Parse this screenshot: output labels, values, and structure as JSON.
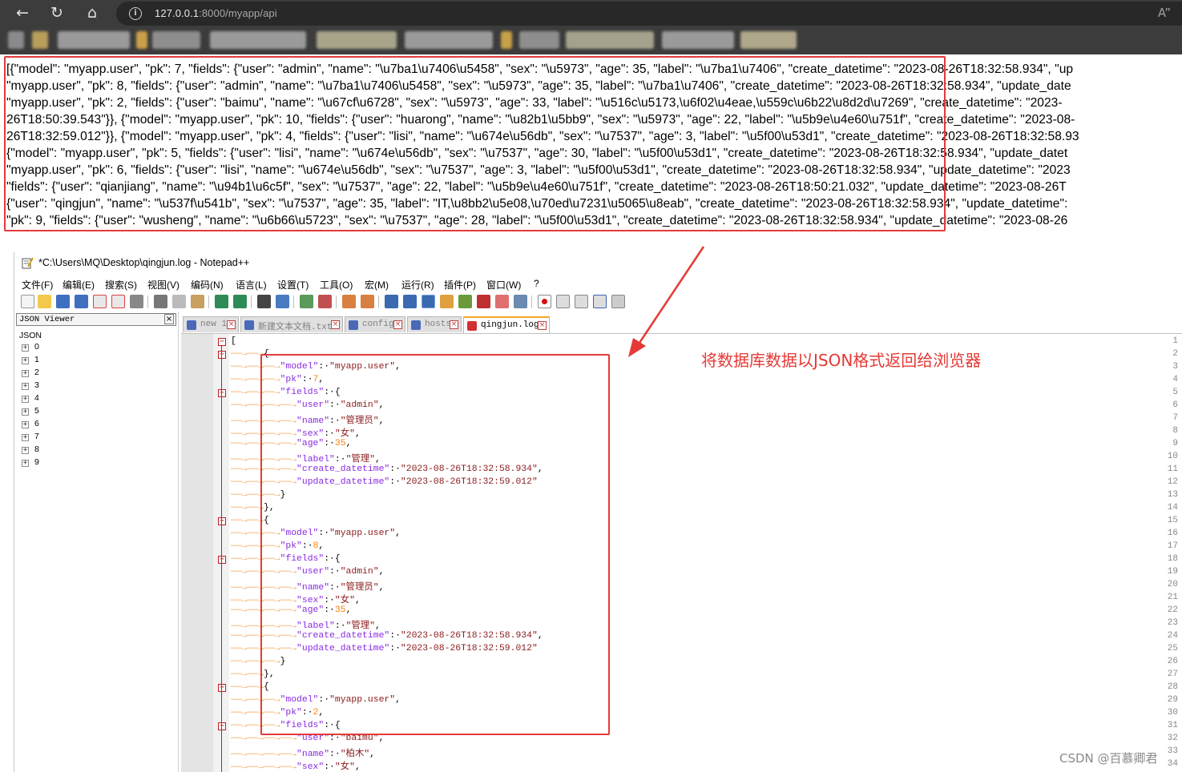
{
  "browser": {
    "url_host": "127.0.0.1",
    "url_rest": ":8000/myapp/api",
    "icons": [
      "back-icon",
      "reload-icon",
      "home-icon",
      "info-icon",
      "reader-mode-icon"
    ]
  },
  "response": {
    "lines": [
      "[{\"model\": \"myapp.user\", \"pk\": 7, \"fields\": {\"user\": \"admin\", \"name\": \"\\u7ba1\\u7406\\u5458\", \"sex\": \"\\u5973\", \"age\": 35, \"label\": \"\\u7ba1\\u7406\", \"create_datetime\": \"2023-08-26T18:32:58.934\", \"up",
      "\"myapp.user\", \"pk\": 8, \"fields\": {\"user\": \"admin\", \"name\": \"\\u7ba1\\u7406\\u5458\", \"sex\": \"\\u5973\", \"age\": 35, \"label\": \"\\u7ba1\\u7406\", \"create_datetime\": \"2023-08-26T18:32:58.934\", \"update_date",
      "\"myapp.user\", \"pk\": 2, \"fields\": {\"user\": \"baimu\", \"name\": \"\\u67cf\\u6728\", \"sex\": \"\\u5973\", \"age\": 33, \"label\": \"\\u516c\\u5173,\\u6f02\\u4eae,\\u559c\\u6b22\\u8d2d\\u7269\", \"create_datetime\": \"2023-",
      "26T18:50:39.543\"}}, {\"model\": \"myapp.user\", \"pk\": 10, \"fields\": {\"user\": \"huarong\", \"name\": \"\\u82b1\\u5bb9\", \"sex\": \"\\u5973\", \"age\": 22, \"label\": \"\\u5b9e\\u4e60\\u751f\", \"create_datetime\": \"2023-08-",
      "26T18:32:59.012\"}}, {\"model\": \"myapp.user\", \"pk\": 4, \"fields\": {\"user\": \"lisi\", \"name\": \"\\u674e\\u56db\", \"sex\": \"\\u7537\", \"age\": 3, \"label\": \"\\u5f00\\u53d1\", \"create_datetime\": \"2023-08-26T18:32:58.93",
      "{\"model\": \"myapp.user\", \"pk\": 5, \"fields\": {\"user\": \"lisi\", \"name\": \"\\u674e\\u56db\", \"sex\": \"\\u7537\", \"age\": 30, \"label\": \"\\u5f00\\u53d1\", \"create_datetime\": \"2023-08-26T18:32:58.934\", \"update_datet",
      "\"myapp.user\", \"pk\": 6, \"fields\": {\"user\": \"lisi\", \"name\": \"\\u674e\\u56db\", \"sex\": \"\\u7537\", \"age\": 3, \"label\": \"\\u5f00\\u53d1\", \"create_datetime\": \"2023-08-26T18:32:58.934\", \"update_datetime\": \"2023",
      "\"fields\": {\"user\": \"qianjiang\", \"name\": \"\\u94b1\\u6c5f\", \"sex\": \"\\u7537\", \"age\": 22, \"label\": \"\\u5b9e\\u4e60\\u751f\", \"create_datetime\": \"2023-08-26T18:50:21.032\", \"update_datetime\": \"2023-08-26T",
      "{\"user\": \"qingjun\", \"name\": \"\\u537f\\u541b\", \"sex\": \"\\u7537\", \"age\": 35, \"label\": \"IT,\\u8bb2\\u5e08,\\u70ed\\u7231\\u5065\\u8eab\", \"create_datetime\": \"2023-08-26T18:32:58.934\", \"update_datetime\":",
      "\"pk\": 9, \"fields\": {\"user\": \"wusheng\", \"name\": \"\\u6b66\\u5723\", \"sex\": \"\\u7537\", \"age\": 28, \"label\": \"\\u5f00\\u53d1\", \"create_datetime\": \"2023-08-26T18:32:58.934\", \"update_datetime\": \"2023-08-26"
    ]
  },
  "notepad": {
    "title": "*C:\\Users\\MQ\\Desktop\\qingjun.log - Notepad++",
    "menu": [
      "文件(F)",
      "编辑(E)",
      "搜索(S)",
      "视图(V)",
      "编码(N)",
      "语言(L)",
      "设置(T)",
      "工具(O)",
      "宏(M)",
      "运行(R)",
      "插件(P)",
      "窗口(W)",
      "?"
    ],
    "json_viewer": {
      "header": "JSON Viewer",
      "root": "JSON",
      "nodes": [
        "0",
        "1",
        "2",
        "3",
        "4",
        "5",
        "6",
        "7",
        "8",
        "9"
      ]
    },
    "tabs": [
      {
        "label": "new 1",
        "active": false
      },
      {
        "label": "新建文本文档.txt",
        "active": false
      },
      {
        "label": "config",
        "active": false
      },
      {
        "label": "hosts",
        "active": false
      },
      {
        "label": "qingjun.log",
        "active": true
      }
    ],
    "line_numbers": [
      "1",
      "2",
      "3",
      "4",
      "5",
      "6",
      "7",
      "8",
      "9",
      "10",
      "11",
      "12",
      "13",
      "14",
      "15",
      "16",
      "17",
      "18",
      "19",
      "20",
      "21",
      "22",
      "23",
      "24",
      "25",
      "26",
      "27",
      "28",
      "29",
      "30",
      "31",
      "32",
      "33",
      "34"
    ],
    "code_lines": [
      {
        "indent": 0,
        "tokens": [
          [
            "p",
            "["
          ]
        ]
      },
      {
        "indent": 1,
        "tokens": [
          [
            "p",
            "{"
          ]
        ]
      },
      {
        "indent": 2,
        "tokens": [
          [
            "k",
            "\"model\""
          ],
          [
            "p",
            ":·"
          ],
          [
            "s",
            "\"myapp.user\""
          ],
          [
            "p",
            ","
          ]
        ]
      },
      {
        "indent": 2,
        "tokens": [
          [
            "k",
            "\"pk\""
          ],
          [
            "p",
            ":·"
          ],
          [
            "n",
            "7"
          ],
          [
            "p",
            ","
          ]
        ]
      },
      {
        "indent": 2,
        "tokens": [
          [
            "k",
            "\"fields\""
          ],
          [
            "p",
            ":·{"
          ]
        ]
      },
      {
        "indent": 3,
        "tokens": [
          [
            "k",
            "\"user\""
          ],
          [
            "p",
            ":·"
          ],
          [
            "s",
            "\"admin\""
          ],
          [
            "p",
            ","
          ]
        ]
      },
      {
        "indent": 3,
        "tokens": [
          [
            "k",
            "\"name\""
          ],
          [
            "p",
            ":·"
          ],
          [
            "s",
            "\"管理员\""
          ],
          [
            "p",
            ","
          ]
        ]
      },
      {
        "indent": 3,
        "tokens": [
          [
            "k",
            "\"sex\""
          ],
          [
            "p",
            ":·"
          ],
          [
            "s",
            "\"女\""
          ],
          [
            "p",
            ","
          ]
        ]
      },
      {
        "indent": 3,
        "tokens": [
          [
            "k",
            "\"age\""
          ],
          [
            "p",
            ":·"
          ],
          [
            "n",
            "35"
          ],
          [
            "p",
            ","
          ]
        ]
      },
      {
        "indent": 3,
        "tokens": [
          [
            "k",
            "\"label\""
          ],
          [
            "p",
            ":·"
          ],
          [
            "s",
            "\"管理\""
          ],
          [
            "p",
            ","
          ]
        ]
      },
      {
        "indent": 3,
        "tokens": [
          [
            "k",
            "\"create_datetime\""
          ],
          [
            "p",
            ":·"
          ],
          [
            "s",
            "\"2023-08-26T18:32:58.934\""
          ],
          [
            "p",
            ","
          ]
        ]
      },
      {
        "indent": 3,
        "tokens": [
          [
            "k",
            "\"update_datetime\""
          ],
          [
            "p",
            ":·"
          ],
          [
            "s",
            "\"2023-08-26T18:32:59.012\""
          ]
        ]
      },
      {
        "indent": 2,
        "tokens": [
          [
            "p",
            "}"
          ]
        ]
      },
      {
        "indent": 1,
        "tokens": [
          [
            "p",
            "},"
          ]
        ]
      },
      {
        "indent": 1,
        "tokens": [
          [
            "p",
            "{"
          ]
        ]
      },
      {
        "indent": 2,
        "tokens": [
          [
            "k",
            "\"model\""
          ],
          [
            "p",
            ":·"
          ],
          [
            "s",
            "\"myapp.user\""
          ],
          [
            "p",
            ","
          ]
        ]
      },
      {
        "indent": 2,
        "tokens": [
          [
            "k",
            "\"pk\""
          ],
          [
            "p",
            ":·"
          ],
          [
            "n",
            "8"
          ],
          [
            "p",
            ","
          ]
        ]
      },
      {
        "indent": 2,
        "tokens": [
          [
            "k",
            "\"fields\""
          ],
          [
            "p",
            ":·{"
          ]
        ]
      },
      {
        "indent": 3,
        "tokens": [
          [
            "k",
            "\"user\""
          ],
          [
            "p",
            ":·"
          ],
          [
            "s",
            "\"admin\""
          ],
          [
            "p",
            ","
          ]
        ]
      },
      {
        "indent": 3,
        "tokens": [
          [
            "k",
            "\"name\""
          ],
          [
            "p",
            ":·"
          ],
          [
            "s",
            "\"管理员\""
          ],
          [
            "p",
            ","
          ]
        ]
      },
      {
        "indent": 3,
        "tokens": [
          [
            "k",
            "\"sex\""
          ],
          [
            "p",
            ":·"
          ],
          [
            "s",
            "\"女\""
          ],
          [
            "p",
            ","
          ]
        ]
      },
      {
        "indent": 3,
        "tokens": [
          [
            "k",
            "\"age\""
          ],
          [
            "p",
            ":·"
          ],
          [
            "n",
            "35"
          ],
          [
            "p",
            ","
          ]
        ]
      },
      {
        "indent": 3,
        "tokens": [
          [
            "k",
            "\"label\""
          ],
          [
            "p",
            ":·"
          ],
          [
            "s",
            "\"管理\""
          ],
          [
            "p",
            ","
          ]
        ]
      },
      {
        "indent": 3,
        "tokens": [
          [
            "k",
            "\"create_datetime\""
          ],
          [
            "p",
            ":·"
          ],
          [
            "s",
            "\"2023-08-26T18:32:58.934\""
          ],
          [
            "p",
            ","
          ]
        ]
      },
      {
        "indent": 3,
        "tokens": [
          [
            "k",
            "\"update_datetime\""
          ],
          [
            "p",
            ":·"
          ],
          [
            "s",
            "\"2023-08-26T18:32:59.012\""
          ]
        ]
      },
      {
        "indent": 2,
        "tokens": [
          [
            "p",
            "}"
          ]
        ]
      },
      {
        "indent": 1,
        "tokens": [
          [
            "p",
            "},"
          ]
        ]
      },
      {
        "indent": 1,
        "tokens": [
          [
            "p",
            "{"
          ]
        ]
      },
      {
        "indent": 2,
        "tokens": [
          [
            "k",
            "\"model\""
          ],
          [
            "p",
            ":·"
          ],
          [
            "s",
            "\"myapp.user\""
          ],
          [
            "p",
            ","
          ]
        ]
      },
      {
        "indent": 2,
        "tokens": [
          [
            "k",
            "\"pk\""
          ],
          [
            "p",
            ":·"
          ],
          [
            "n",
            "2"
          ],
          [
            "p",
            ","
          ]
        ]
      },
      {
        "indent": 2,
        "tokens": [
          [
            "k",
            "\"fields\""
          ],
          [
            "p",
            ":·{"
          ]
        ]
      },
      {
        "indent": 3,
        "tokens": [
          [
            "k",
            "\"user\""
          ],
          [
            "p",
            ":·"
          ],
          [
            "s",
            "\"baimu\""
          ],
          [
            "p",
            ","
          ]
        ]
      },
      {
        "indent": 3,
        "tokens": [
          [
            "k",
            "\"name\""
          ],
          [
            "p",
            ":·"
          ],
          [
            "s",
            "\"柏木\""
          ],
          [
            "p",
            ","
          ]
        ]
      },
      {
        "indent": 3,
        "tokens": [
          [
            "k",
            "\"sex\""
          ],
          [
            "p",
            ":·"
          ],
          [
            "s",
            "\"女\""
          ],
          [
            "p",
            ","
          ]
        ]
      }
    ],
    "fold_markers": [
      1,
      2,
      5,
      15,
      18,
      28,
      31
    ]
  },
  "annotation": {
    "text": "将数据库数据以JSON格式返回给浏览器",
    "color": "#e53935"
  },
  "watermark": "CSDN @百慕卿君",
  "colors": {
    "key": "#8a2be2",
    "string": "#8b1a1a",
    "number": "#ff8000",
    "highlight_box": "#e33a3a"
  }
}
